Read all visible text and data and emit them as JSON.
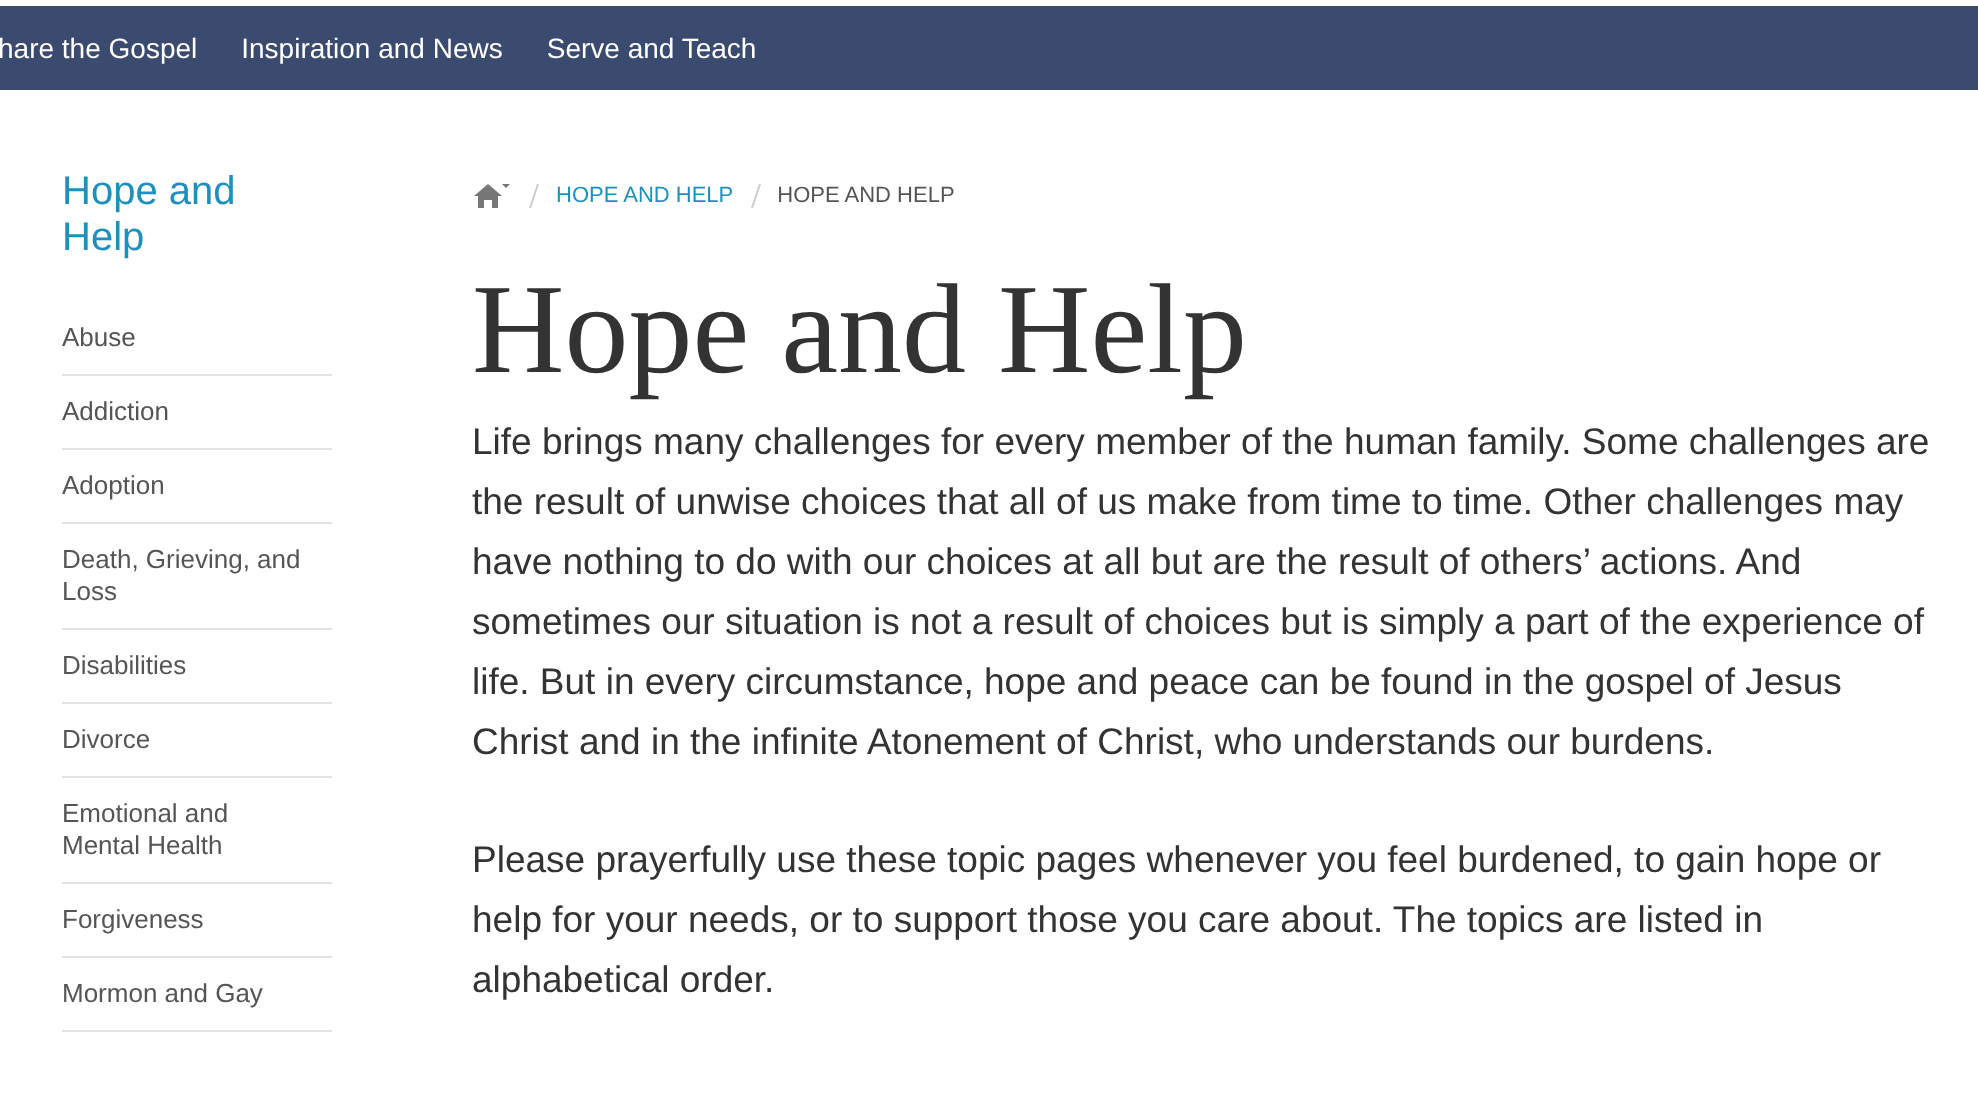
{
  "top_nav": [
    "hare the Gospel",
    "Inspiration and News",
    "Serve and Teach"
  ],
  "sidebar": {
    "title": "Hope and Help",
    "items": [
      "Abuse",
      "Addiction",
      "Adoption",
      "Death, Grieving, and Loss",
      "Disabilities",
      "Divorce",
      "Emotional and Mental Health",
      "Forgiveness",
      "Mormon and Gay"
    ]
  },
  "breadcrumb": [
    {
      "label": "HOPE AND HELP",
      "kind": "link"
    },
    {
      "label": "HOPE AND HELP",
      "kind": "current"
    }
  ],
  "heading": "Hope and Help",
  "paragraphs": [
    "Life brings many challenges for every member of the human family. Some challenges are the result of unwise choices that all of us make from time to time. Other challenges may have nothing to do with our choices at all but are the result of others’ actions. And sometimes our situation is not a result of choices but is simply a part of the experience of life. But in every circumstance, hope and peace can be found in the gospel of Jesus Christ and in the infinite Atonement of Christ, who understands our burdens.",
    "Please prayerfully use these topic pages whenever you feel burdened, to gain hope or help for your needs, or to support those you care about. The topics are listed in alphabetical order."
  ]
}
